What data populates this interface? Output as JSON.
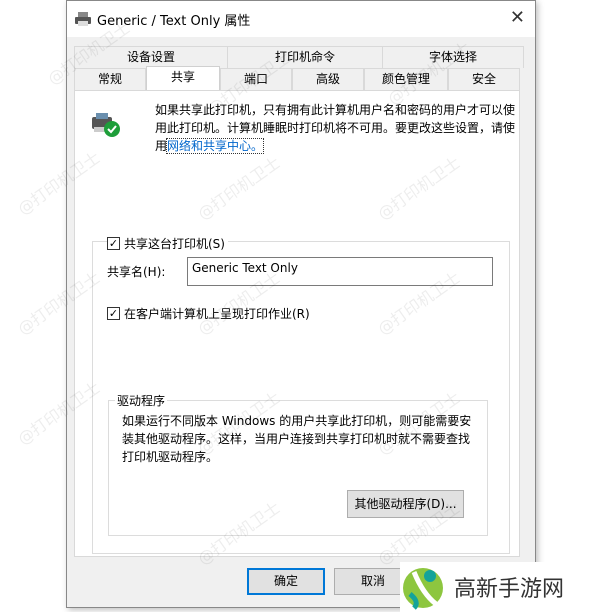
{
  "window": {
    "title": "Generic / Text Only 属性",
    "icon": "printer-icon"
  },
  "tabs_row1": [
    "设备设置",
    "打印机命令",
    "字体选择"
  ],
  "tabs_row2": [
    "常规",
    "共享",
    "端口",
    "高级",
    "颜色管理",
    "安全"
  ],
  "selected_tab": "共享",
  "info": {
    "text": "如果共享此打印机，只有拥有此计算机用户名和密码的用户才可以使用此打印机。计算机睡眠时打印机将不可用。要更改这些设置，请使用",
    "link": "网络和共享中心。"
  },
  "share": {
    "checkbox_label": "共享这台打印机(S)",
    "checked": true,
    "name_label": "共享名(H):",
    "name_value": "Generic  Text Only",
    "render_label": "在客户端计算机上呈现打印作业(R)",
    "render_checked": true
  },
  "driver": {
    "group_label": "驱动程序",
    "text": "如果运行不同版本 Windows 的用户共享此打印机，则可能需要安装其他驱动程序。这样，当用户连接到共享打印机时就不需要查找打印机驱动程序。",
    "button": "其他驱动程序(D)..."
  },
  "buttons": {
    "ok": "确定",
    "cancel": "取消"
  },
  "watermark": "@打印机卫士",
  "logo": {
    "text": "高新手游网"
  },
  "colors": {
    "accent": "#0078d7",
    "link": "#0066cc",
    "check": "#1e9e3a"
  }
}
